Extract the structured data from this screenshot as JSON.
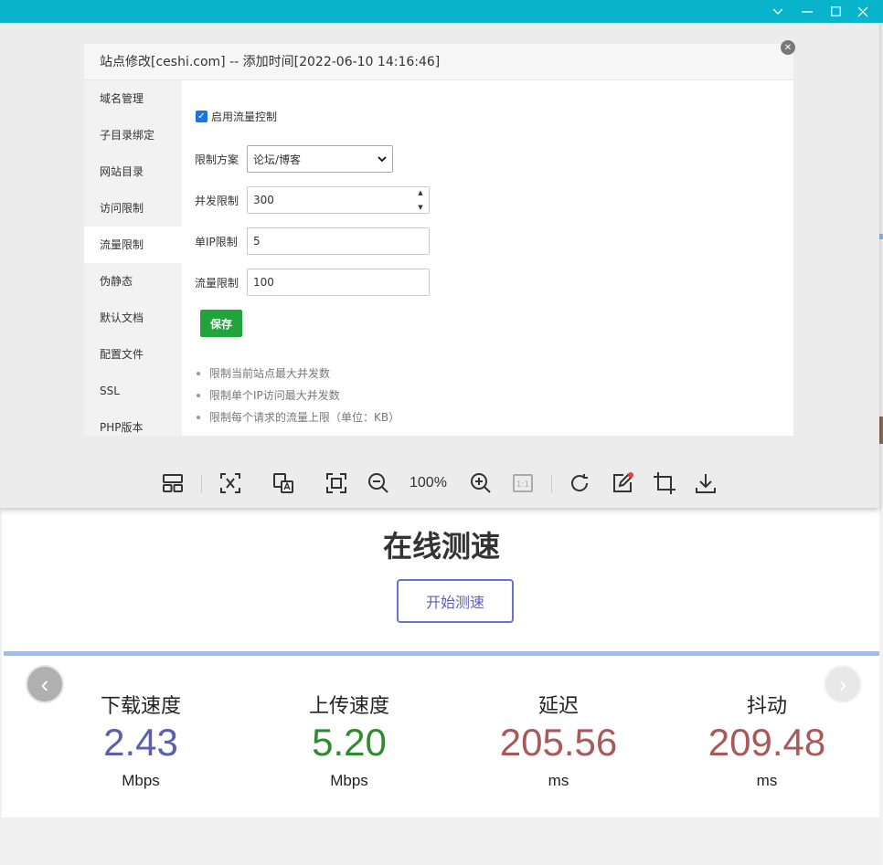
{
  "titlebar": {
    "controls": [
      "chevron-down-icon",
      "minimize-icon",
      "maximize-icon",
      "close-icon"
    ]
  },
  "dialog": {
    "title": "站点修改[ceshi.com] -- 添加时间[2022-06-10 14:16:46]",
    "sidebar": {
      "items": [
        {
          "label": "域名管理"
        },
        {
          "label": "子目录绑定"
        },
        {
          "label": "网站目录"
        },
        {
          "label": "访问限制"
        },
        {
          "label": "流量限制"
        },
        {
          "label": "伪静态"
        },
        {
          "label": "默认文档"
        },
        {
          "label": "配置文件"
        },
        {
          "label": "SSL"
        },
        {
          "label": "PHP版本"
        }
      ],
      "active": "流量限制"
    },
    "form": {
      "enable_label": "启用流量控制",
      "enable_checked": true,
      "scheme_label": "限制方案",
      "scheme_value": "论坛/博客",
      "concurrency_label": "并发限制",
      "concurrency_value": "300",
      "per_ip_label": "单IP限制",
      "per_ip_value": "5",
      "traffic_label": "流量限制",
      "traffic_value": "100",
      "save_label": "保存"
    },
    "tips": [
      "限制当前站点最大并发数",
      "限制单个IP访问最大并发数",
      "限制每个请求的流量上限（单位：KB）"
    ]
  },
  "viewer_toolbar": {
    "zoom": "100%"
  },
  "speedtest": {
    "title": "在线测速",
    "start_label": "开始测速",
    "metrics": [
      {
        "label": "下载速度",
        "value": "2.43",
        "unit": "Mbps",
        "color": "#5a5fb0"
      },
      {
        "label": "上传速度",
        "value": "5.20",
        "unit": "Mbps",
        "color": "#2e8b2e"
      },
      {
        "label": "延迟",
        "value": "205.56",
        "unit": "ms",
        "color": "#a85a5a"
      },
      {
        "label": "抖动",
        "value": "209.48",
        "unit": "ms",
        "color": "#a85a5a"
      }
    ]
  },
  "colors": {
    "titlebar": "#07b4cc",
    "save_button": "#20a53a",
    "start_button_border": "#6a6fd6",
    "divider": "#9ac0ee"
  }
}
